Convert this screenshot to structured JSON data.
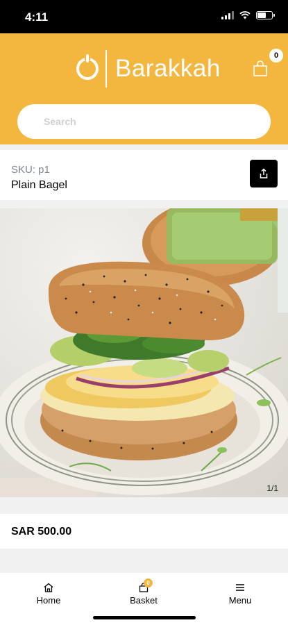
{
  "status_bar": {
    "time": "4:11"
  },
  "header": {
    "brand_name": "Barakkah",
    "cart_count": "0"
  },
  "search": {
    "placeholder": "Search"
  },
  "product": {
    "sku": "SKU: p1",
    "name": "Plain Bagel",
    "image_counter": "1/1",
    "price": "SAR 500.00"
  },
  "tab_bar": {
    "home_label": "Home",
    "basket_label": "Basket",
    "basket_count": "0",
    "menu_label": "Menu"
  },
  "colors": {
    "brand_yellow": "#f3b63e",
    "status_bar": "#000000"
  }
}
